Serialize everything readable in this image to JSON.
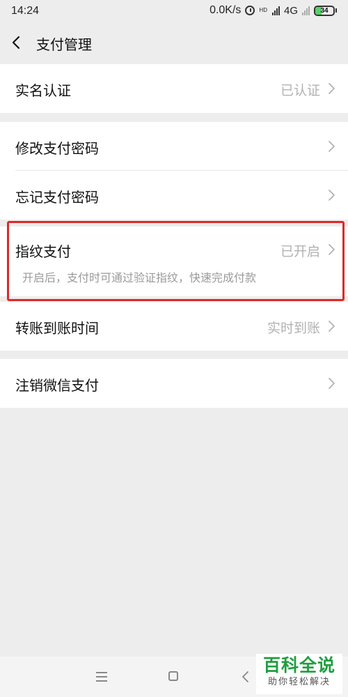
{
  "status_bar": {
    "time": "14:24",
    "net_speed": "0.0K/s",
    "hd_label": "HD",
    "network_type": "4G",
    "network_sub": "ıl",
    "battery": "34",
    "battery_level": 0.34
  },
  "header": {
    "back_icon": "chevron-left-icon",
    "title": "支付管理"
  },
  "settings": {
    "real_name": {
      "label": "实名认证",
      "value": "已认证"
    },
    "change_password": {
      "label": "修改支付密码"
    },
    "forgot_password": {
      "label": "忘记支付密码"
    },
    "fingerprint": {
      "label": "指纹支付",
      "value": "已开启",
      "description": "开启后，支付时可通过验证指纹，快速完成付款"
    },
    "transfer_time": {
      "label": "转账到账时间",
      "value": "实时到账"
    },
    "deregister": {
      "label": "注销微信支付"
    }
  },
  "highlight_color": "#e02828",
  "bottom_nav": {
    "menu_icon": "menu-icon",
    "home_icon": "home-square-icon",
    "back_icon": "back-triangle-icon"
  },
  "watermark": {
    "main": "百科全说",
    "sub": "助你轻松解决"
  }
}
